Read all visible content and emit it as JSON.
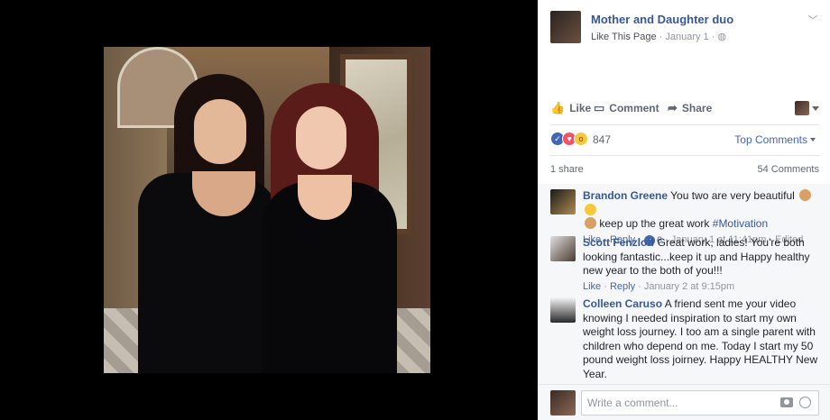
{
  "post": {
    "page_name": "Mother and Daughter duo",
    "like_page_label": "Like This Page",
    "separator": " · ",
    "date": "January 1",
    "privacy_icon": "globe-icon"
  },
  "actions": {
    "like_label": "Like",
    "comment_label": "Comment",
    "share_label": "Share"
  },
  "reactions": {
    "count": "847",
    "top_comments_label": "Top Comments"
  },
  "counts": {
    "shares": "1 share",
    "comments": "54 Comments"
  },
  "comments": [
    {
      "author": "Brandon Greene",
      "text": "You two are very beautiful",
      "text2": "keep up the great work",
      "tag": "#Motivation",
      "like_label": "Like",
      "reply_label": "Reply",
      "likes": "6",
      "time": "January 1 at 11:41pm",
      "edited": "Edited"
    },
    {
      "author": "Scott Fenzloff",
      "text": "Great work, ladies! You're both looking fantastic...keep it up and Happy healthy new year to the both of you!!!",
      "like_label": "Like",
      "reply_label": "Reply",
      "time": "January 2 at 9:15pm"
    },
    {
      "author": "Colleen Caruso",
      "text": "A friend sent me your video knowing I needed inspiration to start my own weight loss journey. I too am a single parent with children who depend on me. Today I start my 50 pound weight loss joirney. Happy HEALTHY New Year."
    }
  ],
  "composer": {
    "placeholder": "Write a comment..."
  },
  "colors": {
    "link": "#365899",
    "accent": "#4267b2",
    "meta": "#90949c"
  }
}
